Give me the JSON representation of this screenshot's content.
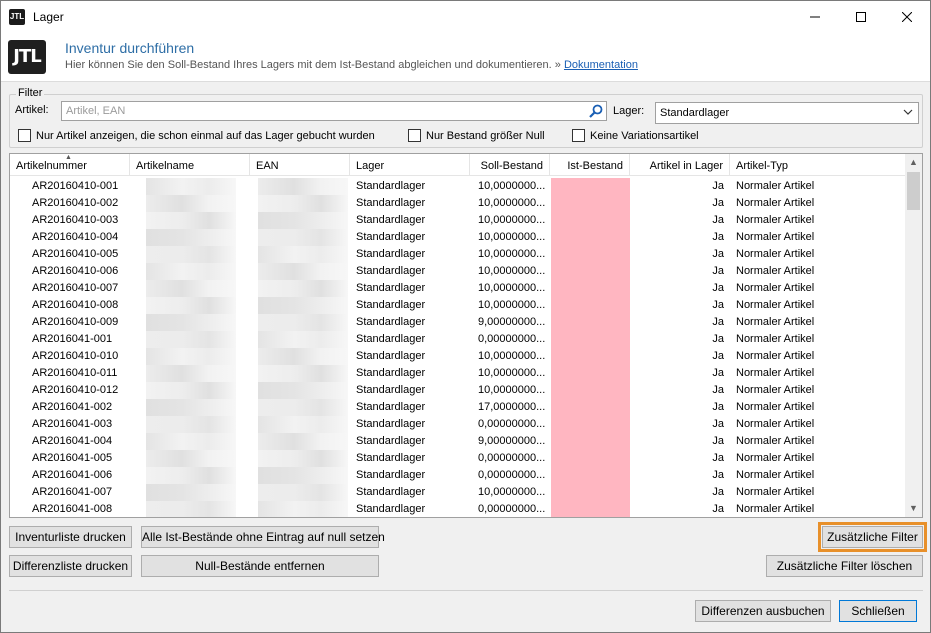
{
  "window": {
    "title": "Lager",
    "app_icon_text": "JTL"
  },
  "header": {
    "logo_text": "JTL",
    "title": "Inventur durchführen",
    "subtitle": "Hier können Sie den Soll-Bestand Ihres Lagers mit dem Ist-Bestand abgleichen und dokumentieren. » ",
    "doc_link": "Dokumentation"
  },
  "filter": {
    "group_label": "Filter",
    "artikel_label": "Artikel:",
    "artikel_placeholder": "Artikel, EAN",
    "lager_label": "Lager:",
    "lager_value": "Standardlager",
    "checkbox1": "Nur Artikel anzeigen, die schon einmal auf das Lager gebucht wurden",
    "checkbox2": "Nur Bestand größer Null",
    "checkbox3": "Keine Variationsartikel"
  },
  "grid": {
    "columns": [
      "Artikelnummer",
      "Artikelname",
      "EAN",
      "Lager",
      "Soll-Bestand",
      "Ist-Bestand",
      "Artikel in Lager",
      "Artikel-Typ"
    ],
    "ist_color": "#ffb6c1",
    "rows": [
      {
        "nr": "AR20160410-001",
        "lager": "Standardlager",
        "soll": "10,0000000...",
        "in_lager": "Ja",
        "typ": "Normaler Artikel"
      },
      {
        "nr": "AR20160410-002",
        "lager": "Standardlager",
        "soll": "10,0000000...",
        "in_lager": "Ja",
        "typ": "Normaler Artikel"
      },
      {
        "nr": "AR20160410-003",
        "lager": "Standardlager",
        "soll": "10,0000000...",
        "in_lager": "Ja",
        "typ": "Normaler Artikel"
      },
      {
        "nr": "AR20160410-004",
        "lager": "Standardlager",
        "soll": "10,0000000...",
        "in_lager": "Ja",
        "typ": "Normaler Artikel"
      },
      {
        "nr": "AR20160410-005",
        "lager": "Standardlager",
        "soll": "10,0000000...",
        "in_lager": "Ja",
        "typ": "Normaler Artikel"
      },
      {
        "nr": "AR20160410-006",
        "lager": "Standardlager",
        "soll": "10,0000000...",
        "in_lager": "Ja",
        "typ": "Normaler Artikel"
      },
      {
        "nr": "AR20160410-007",
        "lager": "Standardlager",
        "soll": "10,0000000...",
        "in_lager": "Ja",
        "typ": "Normaler Artikel"
      },
      {
        "nr": "AR20160410-008",
        "lager": "Standardlager",
        "soll": "10,0000000...",
        "in_lager": "Ja",
        "typ": "Normaler Artikel"
      },
      {
        "nr": "AR20160410-009",
        "lager": "Standardlager",
        "soll": "9,00000000...",
        "in_lager": "Ja",
        "typ": "Normaler Artikel"
      },
      {
        "nr": "AR2016041-001",
        "lager": "Standardlager",
        "soll": "0,00000000...",
        "in_lager": "Ja",
        "typ": "Normaler Artikel"
      },
      {
        "nr": "AR20160410-010",
        "lager": "Standardlager",
        "soll": "10,0000000...",
        "in_lager": "Ja",
        "typ": "Normaler Artikel"
      },
      {
        "nr": "AR20160410-011",
        "lager": "Standardlager",
        "soll": "10,0000000...",
        "in_lager": "Ja",
        "typ": "Normaler Artikel"
      },
      {
        "nr": "AR20160410-012",
        "lager": "Standardlager",
        "soll": "10,0000000...",
        "in_lager": "Ja",
        "typ": "Normaler Artikel"
      },
      {
        "nr": "AR2016041-002",
        "lager": "Standardlager",
        "soll": "17,0000000...",
        "in_lager": "Ja",
        "typ": "Normaler Artikel"
      },
      {
        "nr": "AR2016041-003",
        "lager": "Standardlager",
        "soll": "0,00000000...",
        "in_lager": "Ja",
        "typ": "Normaler Artikel"
      },
      {
        "nr": "AR2016041-004",
        "lager": "Standardlager",
        "soll": "9,00000000...",
        "in_lager": "Ja",
        "typ": "Normaler Artikel"
      },
      {
        "nr": "AR2016041-005",
        "lager": "Standardlager",
        "soll": "0,00000000...",
        "in_lager": "Ja",
        "typ": "Normaler Artikel"
      },
      {
        "nr": "AR2016041-006",
        "lager": "Standardlager",
        "soll": "0,00000000...",
        "in_lager": "Ja",
        "typ": "Normaler Artikel"
      },
      {
        "nr": "AR2016041-007",
        "lager": "Standardlager",
        "soll": "10,0000000...",
        "in_lager": "Ja",
        "typ": "Normaler Artikel"
      },
      {
        "nr": "AR2016041-008",
        "lager": "Standardlager",
        "soll": "0,00000000...",
        "in_lager": "Ja",
        "typ": "Normaler Artikel"
      }
    ]
  },
  "buttons": {
    "inventurliste": "Inventurliste drucken",
    "null_setzen": "Alle Ist-Bestände ohne Eintrag auf null setzen",
    "zusatz_filter": "Zusätzliche Filter",
    "differenzliste": "Differenzliste drucken",
    "null_entfernen": "Null-Bestände entfernen",
    "filter_loeschen": "Zusätzliche Filter löschen",
    "ausbuchen": "Differenzen ausbuchen",
    "schliessen": "Schließen"
  },
  "accent_color": "#e8902a"
}
